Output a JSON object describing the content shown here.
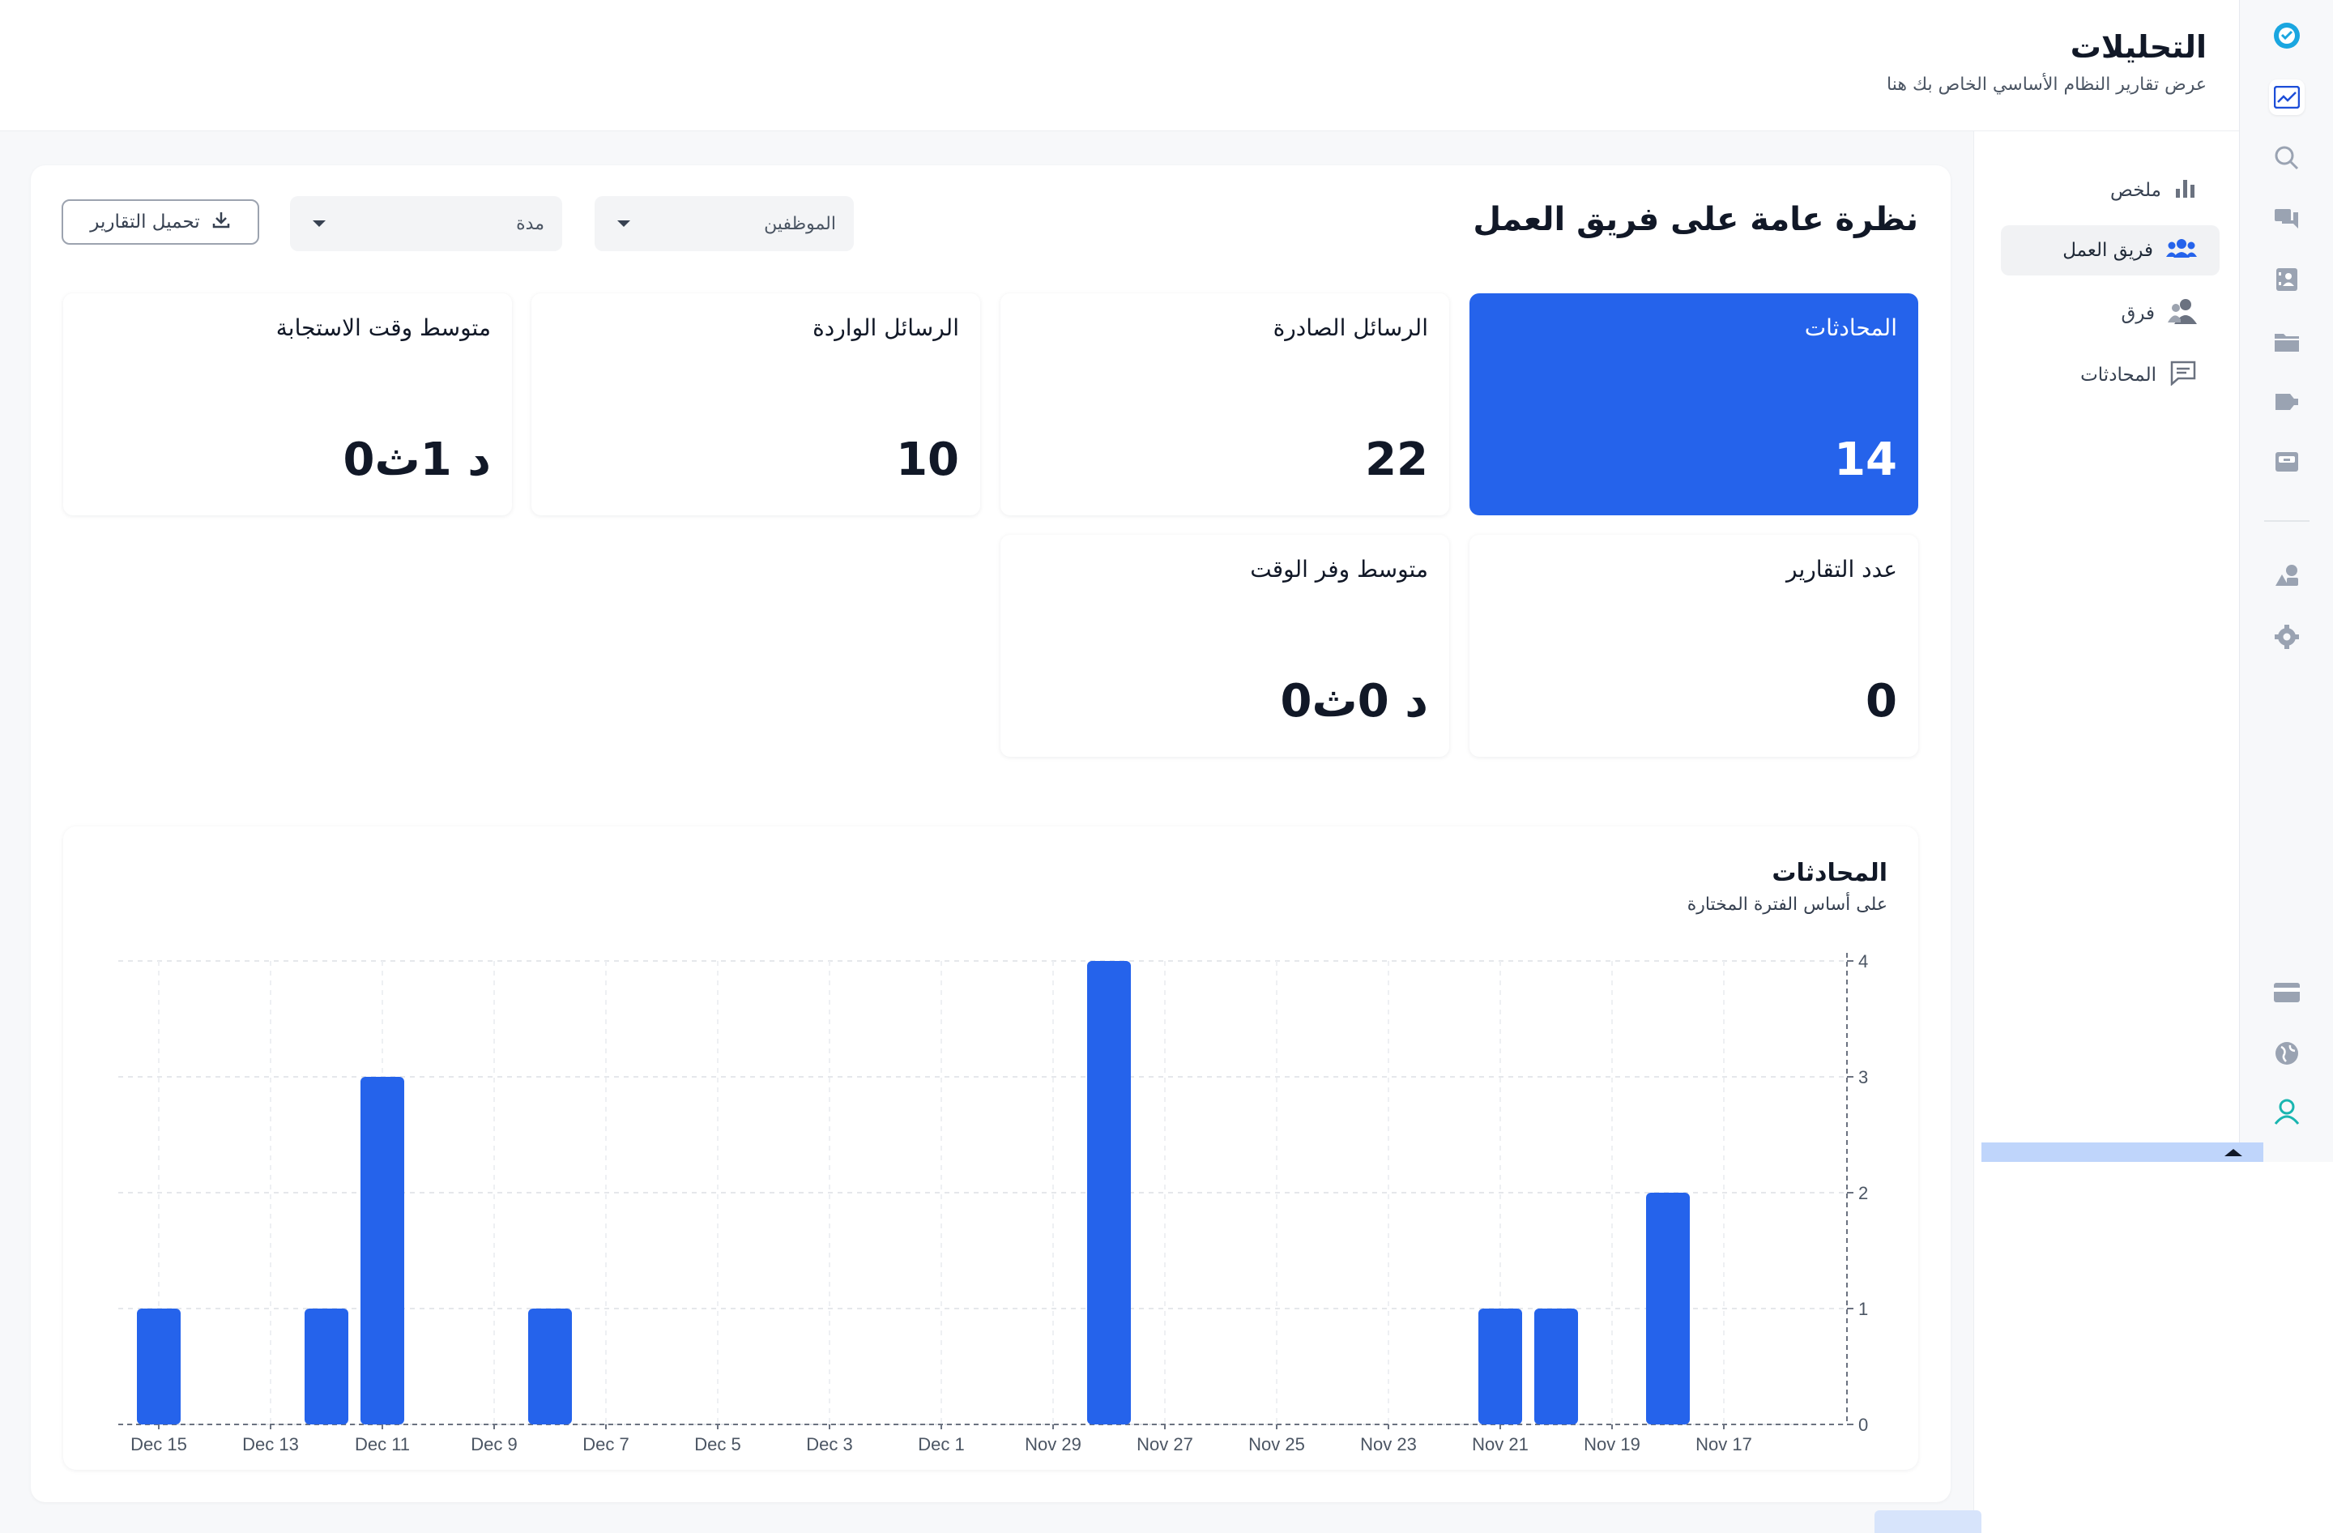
{
  "header": {
    "title": "التحليلات",
    "subtitle": "عرض تقارير النظام الأساسي الخاص بك هنا"
  },
  "rail": {
    "icons": [
      "app-logo-icon",
      "analytics-icon",
      "search-icon",
      "chat-bubbles-icon",
      "contacts-icon",
      "folder-icon",
      "campaign-icon",
      "archive-icon",
      "shapes-icon",
      "settings-icon",
      "billing-icon",
      "globe-icon",
      "user-profile-icon"
    ]
  },
  "subnav": {
    "items": [
      {
        "label": "ملخص",
        "icon": "bar-chart-icon"
      },
      {
        "label": "فريق العمل",
        "icon": "team-icon",
        "active": true
      },
      {
        "label": "فرق",
        "icon": "groups-icon"
      },
      {
        "label": "المحادثات",
        "icon": "conversation-icon"
      }
    ]
  },
  "overview": {
    "title": "نظرة عامة على فريق العمل",
    "employees_select": "الموظفين",
    "period_select": "مدة",
    "download_label": "تحميل التقارير"
  },
  "stats": [
    {
      "label": "المحادثات",
      "value": "14",
      "highlighted": true
    },
    {
      "label": "الرسائل الصادرة",
      "value": "22"
    },
    {
      "label": "الرسائل الواردة",
      "value": "10"
    },
    {
      "label": "متوسط وقت الاستجابة",
      "value": "0د 1ث"
    },
    {
      "label": "عدد التقارير",
      "value": "0"
    },
    {
      "label": "متوسط وفر الوقت",
      "value": "0د 0ث"
    }
  ],
  "chart_data": {
    "type": "bar",
    "title": "المحادثات",
    "subtitle": "على أساس الفترة المختارة",
    "x": [
      "Dec 15",
      "Dec 14",
      "Dec 13",
      "Dec 12",
      "Dec 11",
      "Dec 10",
      "Dec 9",
      "Dec 8",
      "Dec 7",
      "Dec 6",
      "Dec 5",
      "Dec 4",
      "Dec 3",
      "Dec 2",
      "Dec 1",
      "Nov 30",
      "Nov 29",
      "Nov 28",
      "Nov 27",
      "Nov 26",
      "Nov 25",
      "Nov 24",
      "Nov 23",
      "Nov 22",
      "Nov 21",
      "Nov 20",
      "Nov 19",
      "Nov 18",
      "Nov 17",
      "Nov 16"
    ],
    "values": [
      1,
      0,
      0,
      1,
      3,
      0,
      0,
      1,
      0,
      0,
      0,
      0,
      0,
      0,
      0,
      0,
      0,
      4,
      0,
      0,
      0,
      0,
      0,
      0,
      1,
      1,
      0,
      2,
      0,
      0
    ],
    "x_tick_labels": [
      "Dec 15",
      "Dec 13",
      "Dec 11",
      "Dec 9",
      "Dec 7",
      "Dec 5",
      "Dec 3",
      "Dec 1",
      "Nov 29",
      "Nov 27",
      "Nov 25",
      "Nov 23",
      "Nov 21",
      "Nov 19",
      "Nov 17"
    ],
    "y_ticks": [
      0,
      1,
      2,
      3,
      4
    ],
    "ylim": [
      0,
      4
    ],
    "y_axis_side": "right",
    "grid": true,
    "color": "#2563eb"
  },
  "colors": {
    "accent": "#2563eb",
    "rail_bg": "#f7f8fa",
    "brand_teal": "#19b5b0"
  }
}
